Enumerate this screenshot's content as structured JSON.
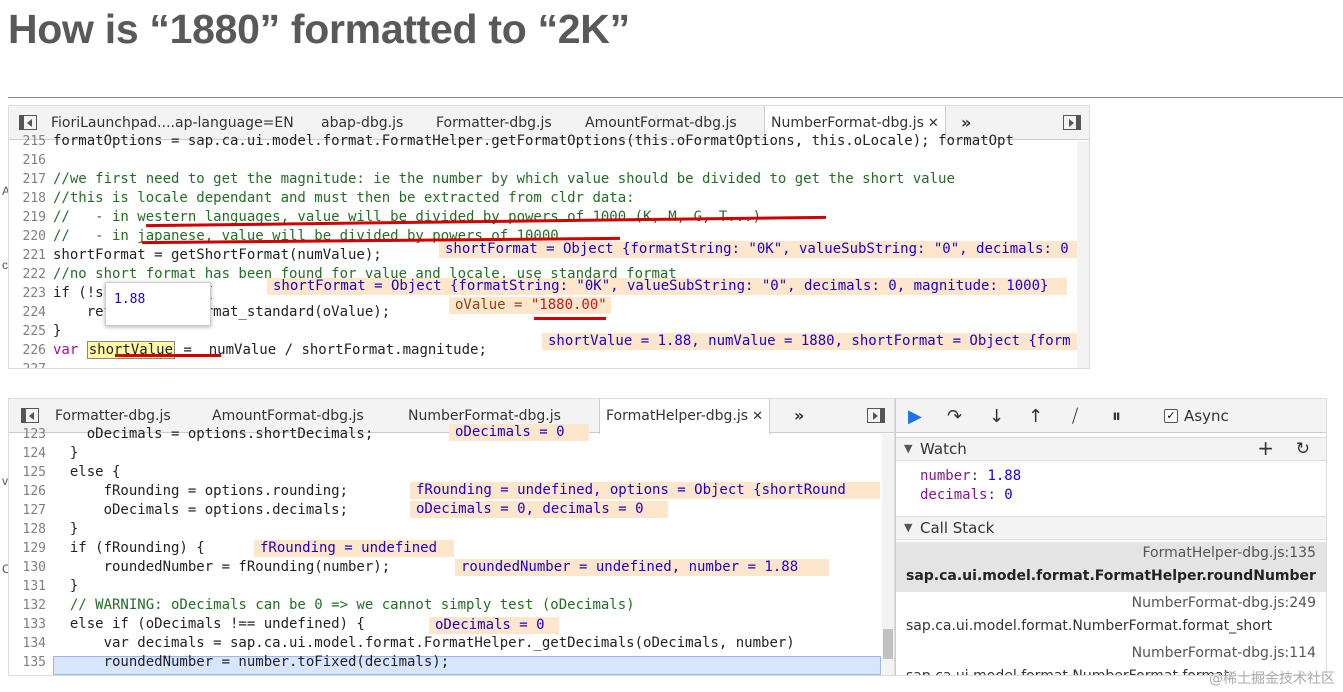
{
  "title": "How is “1880” formatted to “2K”",
  "top_panel": {
    "tabs": [
      "FioriLaunchpad....ap-language=EN",
      "abap-dbg.js",
      "Formatter-dbg.js",
      "AmountFormat-dbg.js",
      "NumberFormat-dbg.js"
    ],
    "more": "»",
    "lines": [
      {
        "n": "215",
        "text": "formatOptions = sap.ca.ui.model.format.FormatHelper.getFormatOptions(this.oFormatOptions, this.oLocale); formatOpt"
      },
      {
        "n": "216",
        "text": ""
      },
      {
        "n": "217",
        "text": "//we first need to get the magnitude: ie the number by which value should be divided to get the short value"
      },
      {
        "n": "218",
        "text": "//this is locale dependant and must then be extracted from cldr data:"
      },
      {
        "n": "219",
        "text": "//   - in western languages, value will be divided by powers of 1000 (K, M, G, T...)"
      },
      {
        "n": "220",
        "text": "//   - in japanese, value will be divided by powers of 10000."
      },
      {
        "n": "221",
        "text": "shortFormat = getShortFormat(numValue);"
      },
      {
        "n": "222",
        "text": "//no short format has been found for value and locale, use standard format"
      },
      {
        "n": "223",
        "text": "if (!shortFormat) {"
      },
      {
        "n": "224",
        "text": "    return this.format_standard(oValue);"
      },
      {
        "n": "225",
        "text": "}"
      },
      {
        "n": "226",
        "text": "var shortValue =  numValue / shortFormat.magnitude;"
      },
      {
        "n": "227",
        "text": ""
      }
    ],
    "inline221": "shortFormat = Object {formatString: \"0K\", valueSubString: \"0\", decimals: 0",
    "inline223": "shortFormat = Object {formatString: \"0K\", valueSubString: \"0\", decimals: 0, magnitude: 1000}",
    "inline224_key": "oValue = ",
    "inline224_val": "\"1880.00\"",
    "inline226": "shortValue = 1.88, numValue = 1880, shortFormat = Object {form",
    "tooltip": "1.88",
    "hl_word": "shortValue"
  },
  "bottom_panel": {
    "tabs": [
      "Formatter-dbg.js",
      "AmountFormat-dbg.js",
      "NumberFormat-dbg.js",
      "FormatHelper-dbg.js"
    ],
    "more": "»",
    "lines": [
      {
        "n": "123",
        "text": "    oDecimals = options.shortDecimals;"
      },
      {
        "n": "124",
        "text": "  }"
      },
      {
        "n": "125",
        "text": "  else {"
      },
      {
        "n": "126",
        "text": "      fRounding = options.rounding;"
      },
      {
        "n": "127",
        "text": "      oDecimals = options.decimals;"
      },
      {
        "n": "128",
        "text": "  }"
      },
      {
        "n": "129",
        "text": "  if (fRounding) {"
      },
      {
        "n": "130",
        "text": "      roundedNumber = fRounding(number);"
      },
      {
        "n": "131",
        "text": "  }"
      },
      {
        "n": "132",
        "text": "  // WARNING: oDecimals can be 0 => we cannot simply test (oDecimals)"
      },
      {
        "n": "133",
        "text": "  else if (oDecimals !== undefined) {"
      },
      {
        "n": "134",
        "text": "      var decimals = sap.ca.ui.model.format.FormatHelper._getDecimals(oDecimals, number)"
      },
      {
        "n": "135",
        "text": "      roundedNumber = number.toFixed(decimals);"
      }
    ],
    "inline123": "oDecimals = 0",
    "inline126": "fRounding = undefined, options = Object {shortRound",
    "inline127": "oDecimals = 0, decimals = 0",
    "inline129": "fRounding = undefined",
    "inline130": "roundedNumber = undefined, number = 1.88",
    "inline133": "oDecimals = 0"
  },
  "debugger": {
    "async_label": "Async",
    "watch_label": "Watch",
    "watch": [
      {
        "k": "number",
        "v": "1.88"
      },
      {
        "k": "decimals",
        "v": "0"
      }
    ],
    "callstack_label": "Call Stack",
    "frames": [
      {
        "file": "FormatHelper-dbg.js:135",
        "fn": "sap.ca.ui.model.format.FormatHelper.roundNumber"
      },
      {
        "file": "NumberFormat-dbg.js:249",
        "fn": "sap.ca.ui.model.format.NumberFormat.format_short"
      },
      {
        "file": "NumberFormat-dbg.js:114",
        "fn": "sap.ca.ui.model.format.NumberFormat.format"
      }
    ]
  },
  "watermark": "@稀土掘金技术社区"
}
